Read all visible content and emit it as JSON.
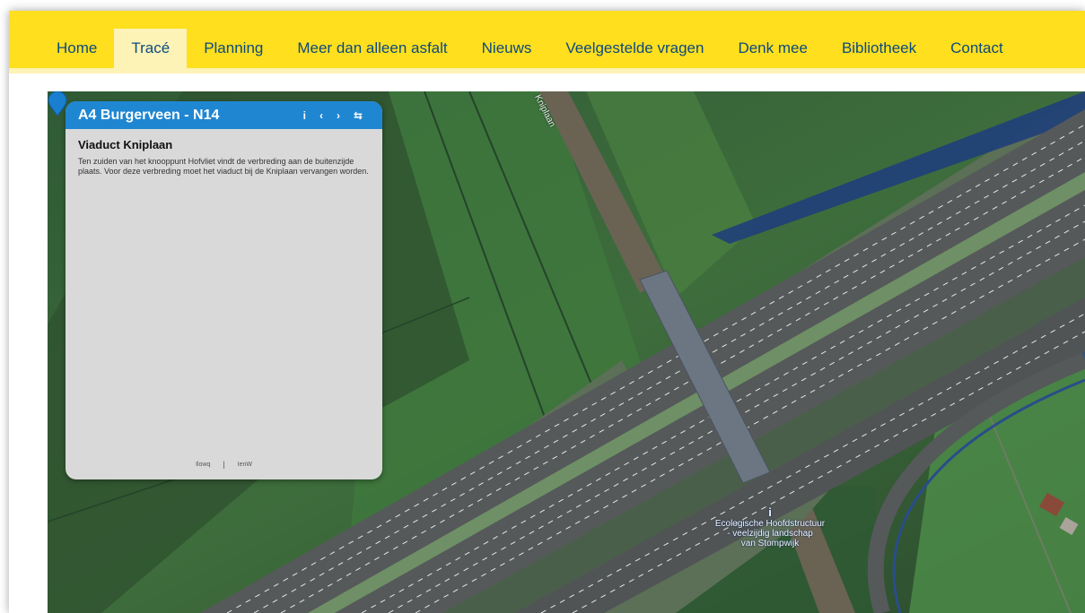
{
  "nav": {
    "items": [
      {
        "label": "Home"
      },
      {
        "label": "Tracé"
      },
      {
        "label": "Planning"
      },
      {
        "label": "Meer dan alleen asfalt"
      },
      {
        "label": "Nieuws"
      },
      {
        "label": "Veelgestelde vragen"
      },
      {
        "label": "Denk mee"
      },
      {
        "label": "Bibliotheek"
      },
      {
        "label": "Contact"
      }
    ],
    "active": "Tracé"
  },
  "map": {
    "road_label": "Kniplaan",
    "poi": {
      "icon": "info-icon",
      "icon_glyph": "i",
      "lines": [
        "Ecologische Hoofdstructuur",
        "- veelzijdig landschap",
        "van Stompwijk"
      ]
    },
    "marker_color": "#1a7fd0"
  },
  "panel": {
    "title": "A4 Burgerveen - N14",
    "tools": {
      "info": "i",
      "prev": "‹",
      "next": "›",
      "share": "⇆"
    },
    "heading": "Viaduct Kniplaan",
    "text": "Ten zuiden van het knooppunt Hofvliet vindt de verbreding aan de buitenzijde plaats. Voor deze verbreding moet het viaduct bij de Kniplaan vervangen worden.",
    "footer": {
      "left": "Ilowq",
      "separator": "|",
      "right": "IenW"
    }
  },
  "colors": {
    "nav_bg": "#ffdf1e",
    "nav_active": "#fdf3b6",
    "nav_text": "#0b4a7e",
    "panel_header": "#1f86d2",
    "panel_bg": "#d9d9d9"
  }
}
